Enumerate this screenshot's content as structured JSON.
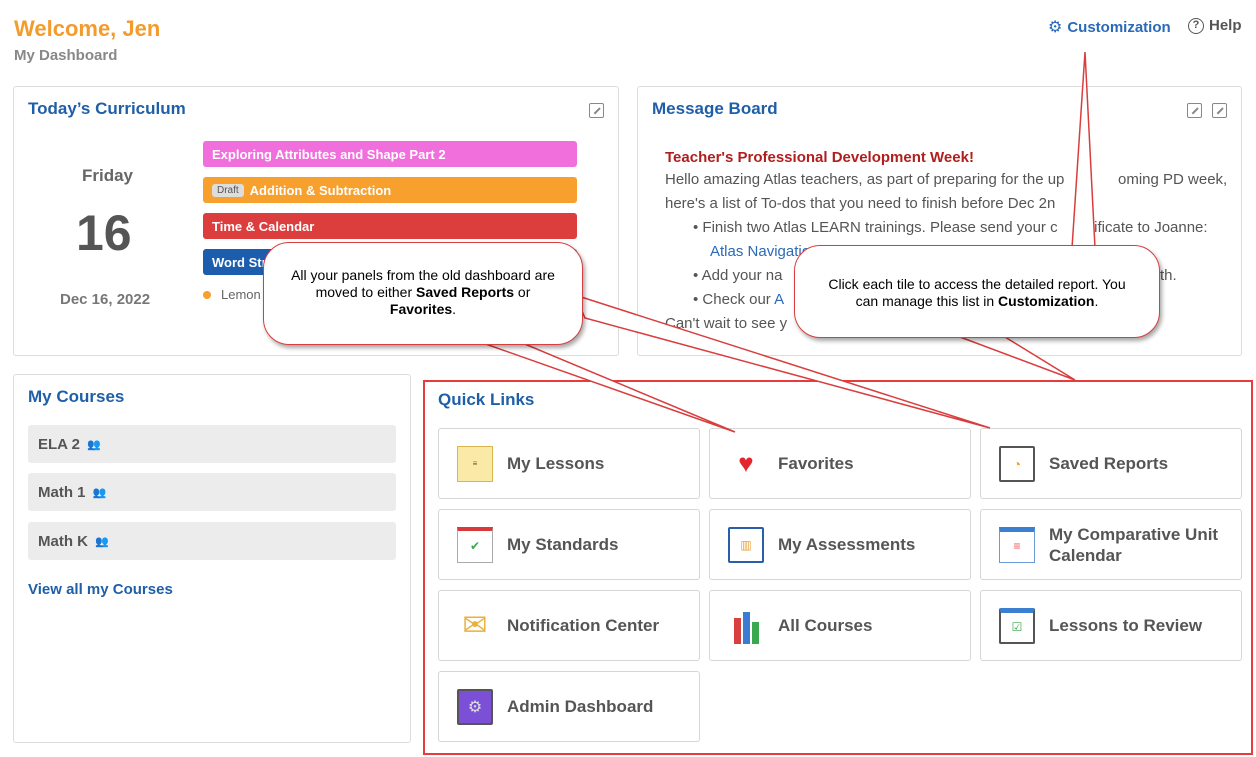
{
  "header": {
    "welcome": "Welcome, Jen",
    "subtitle": "My Dashboard",
    "customization_label": "Customization",
    "help_label": "Help"
  },
  "curriculum": {
    "title": "Today’s Curriculum",
    "day_name": "Friday",
    "day_number": "16",
    "date": "Dec 16, 2022",
    "lessons": [
      {
        "label": "Exploring Attributes and Shape Part 2",
        "color": "#f06fdc"
      },
      {
        "label": "Addition & Subtraction",
        "draft": "Draft",
        "color": "#f7a02e"
      },
      {
        "label": "Time & Calendar",
        "color": "#dc3d3d"
      },
      {
        "label": "Word Str",
        "color": "#1c5dad"
      }
    ],
    "extra_item": "Lemon"
  },
  "message_board": {
    "title": "Message Board",
    "heading": "Teacher's Professional Development Week!",
    "line1": "Hello amazing Atlas teachers, as part of preparing for the up",
    "line1b": "oming PD week,",
    "line2": "here's a list of To-dos that you need to finish before Dec 2n",
    "bullet1": "Finish two Atlas LEARN trainings. Please send your c",
    "bullet1b": "rtificate to Joanne:",
    "bullet1_link": "Atlas Navigation",
    "bullet1_link2": "Atlas Reports",
    "bullet2": "Add your na",
    "bullet2b": "th.",
    "bullet3": "Check our",
    "bullet3_link": "A",
    "closing": "Can't wait to see y"
  },
  "my_courses": {
    "title": "My Courses",
    "items": [
      "ELA 2",
      "Math 1",
      "Math K"
    ],
    "view_all": "View all my Courses"
  },
  "quick_links": {
    "title": "Quick Links",
    "tiles": [
      {
        "label": "My Lessons",
        "icon": "lesson-planning-icon"
      },
      {
        "label": "Favorites",
        "icon": "heart-icon"
      },
      {
        "label": "Saved Reports",
        "icon": "report-monitor-icon"
      },
      {
        "label": "My Standards",
        "icon": "checklist-icon"
      },
      {
        "label": "My Assessments",
        "icon": "clipboard-chart-icon"
      },
      {
        "label": "My Comparative Unit Calendar",
        "icon": "calendar-bars-icon"
      },
      {
        "label": "Notification Center",
        "icon": "envelope-icon"
      },
      {
        "label": "All Courses",
        "icon": "books-icon"
      },
      {
        "label": "Lessons to Review",
        "icon": "review-monitor-icon"
      },
      {
        "label": "Admin Dashboard",
        "icon": "admin-gear-icon"
      }
    ]
  },
  "callouts": {
    "panels_text1": "All your panels from the old dashboard are moved to either ",
    "panels_bold1": "Saved Reports",
    "panels_text2": " or ",
    "panels_bold2": "Favorites",
    "panels_text3": ".",
    "tiles_text1": "Click each tile to access the detailed report. You can manage this list in ",
    "tiles_bold": "Customization",
    "tiles_text2": "."
  }
}
